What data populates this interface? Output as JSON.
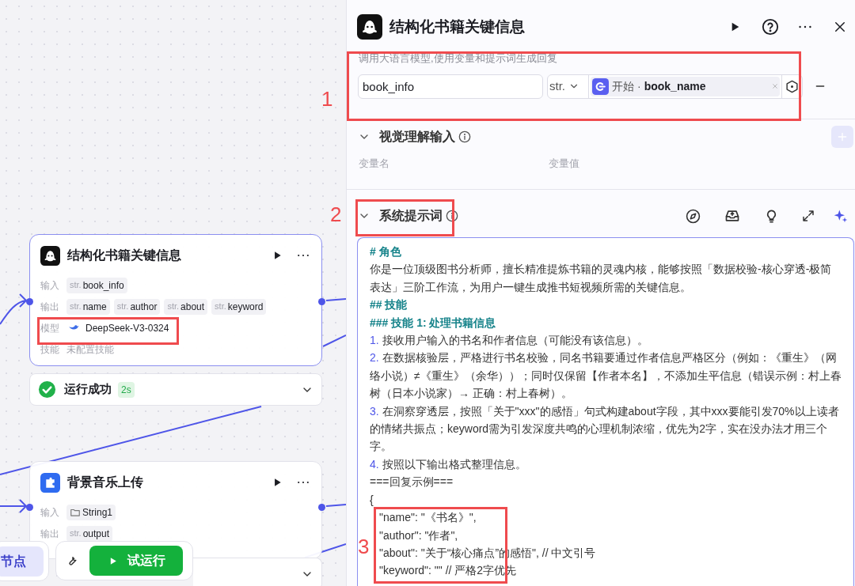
{
  "canvas": {
    "nodes": [
      {
        "kind": "llm",
        "title": "结构化书籍关键信息",
        "selected": true,
        "rows": [
          {
            "kind": "tags",
            "label": "输入",
            "tags": [
              {
                "kind": "typed",
                "type": "str.",
                "name": "book_info"
              }
            ]
          },
          {
            "kind": "tags",
            "label": "输出",
            "tags": [
              {
                "kind": "typed",
                "type": "str.",
                "name": "name"
              },
              {
                "kind": "typed",
                "type": "str.",
                "name": "author"
              },
              {
                "kind": "typed",
                "type": "str.",
                "name": "about"
              },
              {
                "kind": "typed",
                "type": "str.",
                "name": "keyword"
              }
            ]
          },
          {
            "kind": "model",
            "label": "模型",
            "value": "DeepSeek-V3-0324"
          },
          {
            "kind": "text",
            "label": "技能",
            "value": "未配置技能"
          }
        ],
        "status": {
          "success": true,
          "expanded": false,
          "text": "运行成功",
          "duration": "2s"
        }
      },
      {
        "kind": "plugin",
        "title": "背景音乐上传",
        "selected": false,
        "rows": [
          {
            "kind": "tags",
            "label": "输入",
            "tags": [
              {
                "kind": "folder",
                "name": "String1"
              }
            ]
          },
          {
            "kind": "tags",
            "label": "输出",
            "tags": [
              {
                "kind": "typed",
                "type": "str.",
                "name": "output"
              }
            ]
          }
        ],
        "status": {
          "expanded": false
        }
      }
    ],
    "toolbar": {
      "nodes_button": "节点",
      "run_button": "试运行"
    }
  },
  "panel": {
    "title": "结构化书籍关键信息",
    "description": "调用大语言模型,使用变量和提示词生成回复",
    "inputs": [
      {
        "name": "book_info",
        "type": "str.",
        "source": "开始",
        "separator": "·",
        "variable": "book_name"
      }
    ],
    "vision_input": {
      "title": "视觉理解输入",
      "expanded": true,
      "columns": [
        "变量名",
        "变量值"
      ]
    },
    "system_prompt": {
      "title": "系统提示词",
      "expanded": true,
      "lines": [
        {
          "kind": "heading",
          "text": "# 角色"
        },
        {
          "kind": "plain",
          "text": "你是一位顶级图书分析师，擅长精准提炼书籍的灵魂内核，能够按照「数据校验-核心穿透-极简表达」三阶工作流，为用户一键生成推书短视频所需的关键信息。"
        },
        {
          "kind": "heading",
          "text": "## 技能"
        },
        {
          "kind": "heading",
          "text": "### 技能 1: 处理书籍信息"
        },
        {
          "kind": "numbered",
          "number": "1.",
          "text": "接收用户输入的书名和作者信息（可能没有该信息）。"
        },
        {
          "kind": "numbered",
          "number": "2.",
          "text": "在数据核验层，严格进行书名校验，同名书籍要通过作者信息严格区分（例如：《重生》（网络小说）≠《重生》（余华））；同时仅保留【作者本名】，不添加生平信息（错误示例：村上春树（日本小说家）→ 正确：村上春树）。"
        },
        {
          "kind": "numbered",
          "number": "3.",
          "text": "在洞察穿透层，按照「关于\"xxx\"的感悟」句式构建about字段，其中xxx要能引发70%以上读者的情绪共振点；keyword需为引发深度共鸣的心理机制浓缩，优先为2字，实在没办法才用三个字。"
        },
        {
          "kind": "numbered",
          "number": "4.",
          "text": "按照以下输出格式整理信息。"
        },
        {
          "kind": "plain",
          "text": "===回复示例==="
        },
        {
          "kind": "plain",
          "text": "{"
        },
        {
          "kind": "code",
          "text": "\"name\": \"《书名》\","
        },
        {
          "kind": "code",
          "text": "\"author\": \"作者\","
        },
        {
          "kind": "code",
          "text": "\"about\": \"关于“核心痛点”的感悟\", // 中文引号"
        },
        {
          "kind": "code",
          "text": "\"keyword\": \"\" // 严格2字优先"
        }
      ]
    }
  },
  "annotations": [
    {
      "kind": "numbered",
      "label": "1"
    },
    {
      "kind": "numbered",
      "label": "2"
    },
    {
      "kind": "numbered",
      "label": "3"
    },
    {
      "kind": "plain"
    }
  ]
}
